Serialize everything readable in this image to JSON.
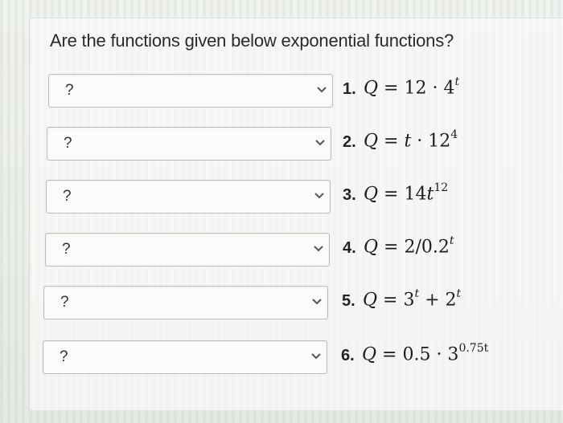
{
  "question": "Are the functions given below exponential functions?",
  "items": [
    {
      "select_value": "?",
      "number": "1.",
      "lhs": "Q",
      "eq": " = ",
      "rhs": "12 · 4",
      "sup": "t"
    },
    {
      "select_value": "?",
      "number": "2.",
      "lhs": "Q",
      "eq": " = ",
      "rhs_var": "t",
      "rhs": " · 12",
      "sup": "4"
    },
    {
      "select_value": "?",
      "number": "3.",
      "lhs": "Q",
      "eq": " = ",
      "rhs": "14",
      "rhs_var": "t",
      "sup": "12"
    },
    {
      "select_value": "?",
      "number": "4.",
      "lhs": "Q",
      "eq": " = ",
      "rhs": "2/0.2",
      "sup": "t"
    },
    {
      "select_value": "?",
      "number": "5.",
      "lhs": "Q",
      "eq": " = ",
      "rhs": "3",
      "sup": "t",
      "rhs2": " + 2",
      "sup2": "t"
    },
    {
      "select_value": "?",
      "number": "6.",
      "lhs": "Q",
      "eq": " = ",
      "rhs": "0.5 · 3",
      "sup": "0.75t"
    }
  ],
  "icons": {
    "dropdown": "chevron-down-icon"
  }
}
